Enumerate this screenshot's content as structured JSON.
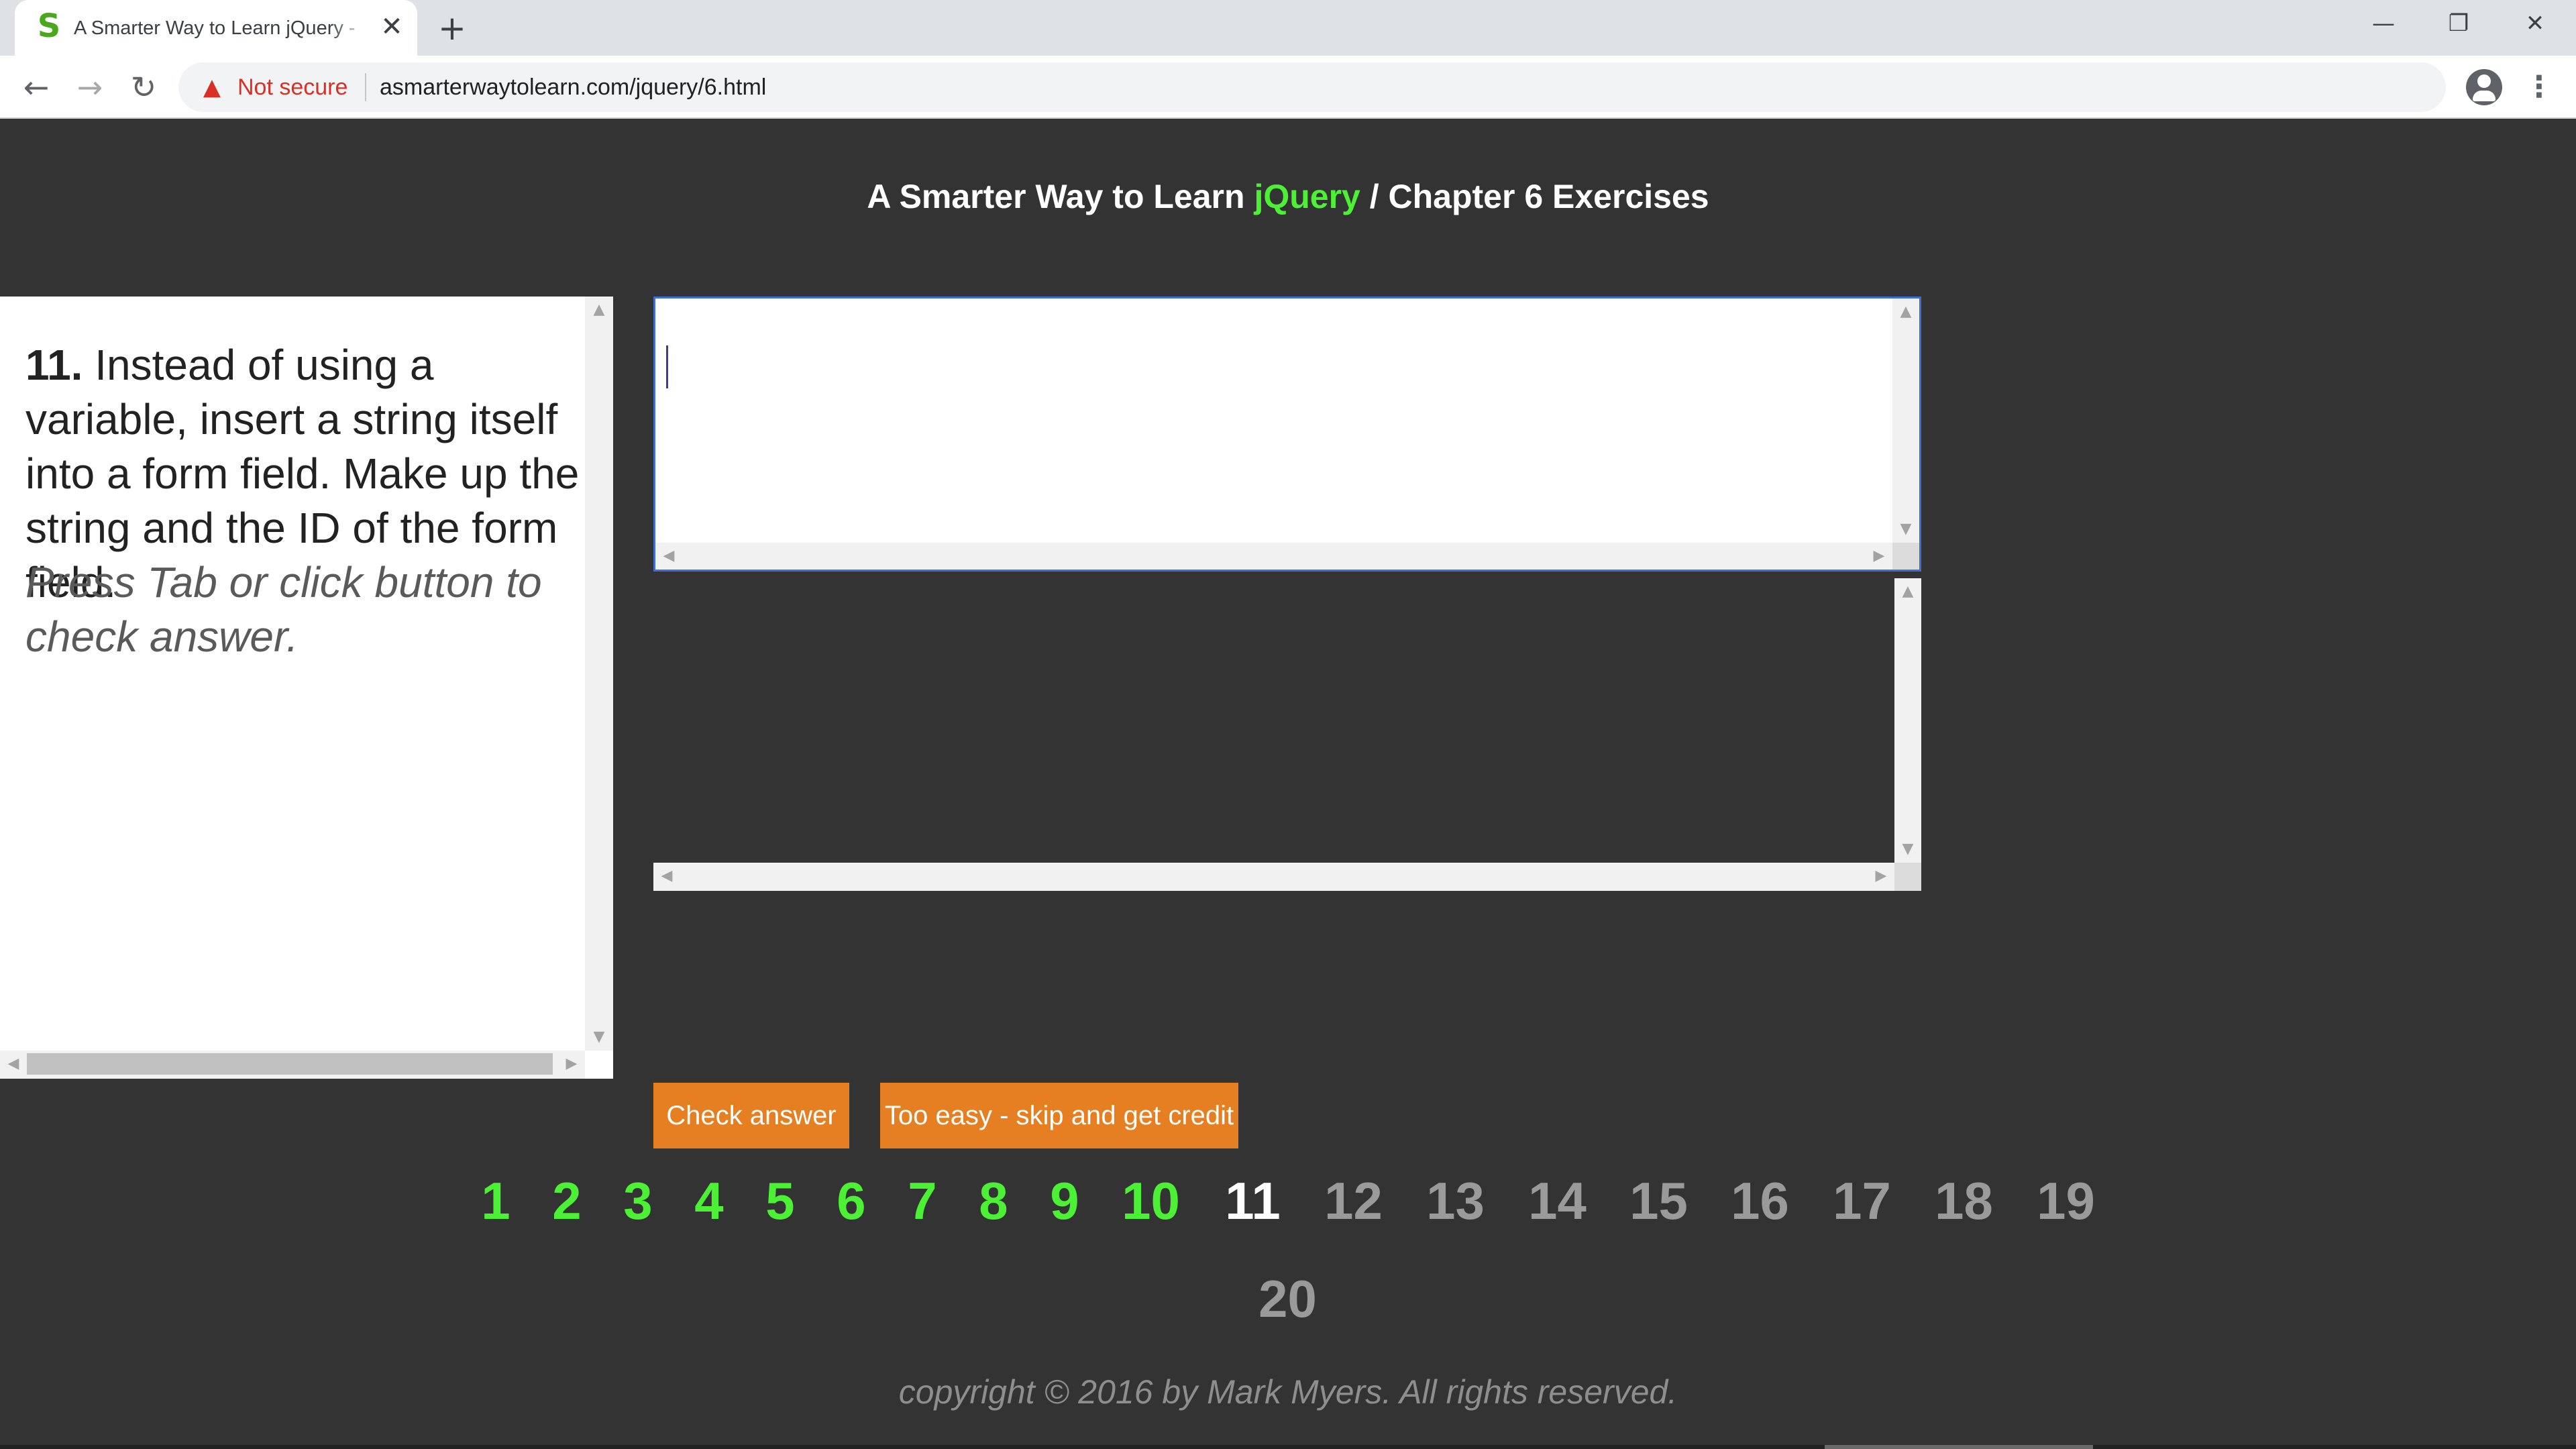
{
  "browser": {
    "tab_title": "A Smarter Way to Learn jQuery - ",
    "tab_favicon": "S",
    "tab_close": "✕",
    "new_tab": "+",
    "window_minimize": "—",
    "window_restore": "❐",
    "window_close": "✕",
    "back_icon": "←",
    "forward_icon": "→",
    "reload_icon": "↻",
    "security_label": "Not secure",
    "url": "asmarterwaytolearn.com/jquery/6.html",
    "icons": [
      "favicon-s-icon",
      "close-icon",
      "plus-icon",
      "minimize-icon",
      "restore-icon",
      "close-window-icon",
      "back-arrow-icon",
      "forward-arrow-icon",
      "reload-icon",
      "warning-triangle-icon",
      "star-icon",
      "profile-avatar-icon",
      "kebab-menu-icon"
    ]
  },
  "header": {
    "prefix": "A Smarter Way to Learn ",
    "accent": "jQuery",
    "suffix": " / Chapter 6 Exercises"
  },
  "exercise": {
    "number": "11.",
    "text": " Instead of using a variable, insert a string itself into a form field. Make up the string and the ID of the form field.",
    "hint": "Press Tab or click button to check answer."
  },
  "editor": {
    "value": ""
  },
  "buttons": {
    "check": "Check answer",
    "skip": "Too easy - skip and get credit"
  },
  "pagination": {
    "pages": [
      {
        "label": "1",
        "state": "done"
      },
      {
        "label": "2",
        "state": "done"
      },
      {
        "label": "3",
        "state": "done"
      },
      {
        "label": "4",
        "state": "done"
      },
      {
        "label": "5",
        "state": "done"
      },
      {
        "label": "6",
        "state": "done"
      },
      {
        "label": "7",
        "state": "done"
      },
      {
        "label": "8",
        "state": "done"
      },
      {
        "label": "9",
        "state": "done"
      },
      {
        "label": "10",
        "state": "done"
      },
      {
        "label": "11",
        "state": "current"
      },
      {
        "label": "12",
        "state": "todo"
      },
      {
        "label": "13",
        "state": "todo"
      },
      {
        "label": "14",
        "state": "todo"
      },
      {
        "label": "15",
        "state": "todo"
      },
      {
        "label": "16",
        "state": "todo"
      },
      {
        "label": "17",
        "state": "todo"
      },
      {
        "label": "18",
        "state": "todo"
      },
      {
        "label": "19",
        "state": "todo"
      },
      {
        "label": "20",
        "state": "todo"
      }
    ]
  },
  "footer": {
    "copyright": "copyright © 2016 by Mark Myers. All rights reserved."
  },
  "colors": {
    "background": "#333333",
    "accent_green": "#4cf035",
    "button_orange": "#e67e22",
    "current_page": "#ffffff",
    "todo_page": "#9a9a9a"
  }
}
